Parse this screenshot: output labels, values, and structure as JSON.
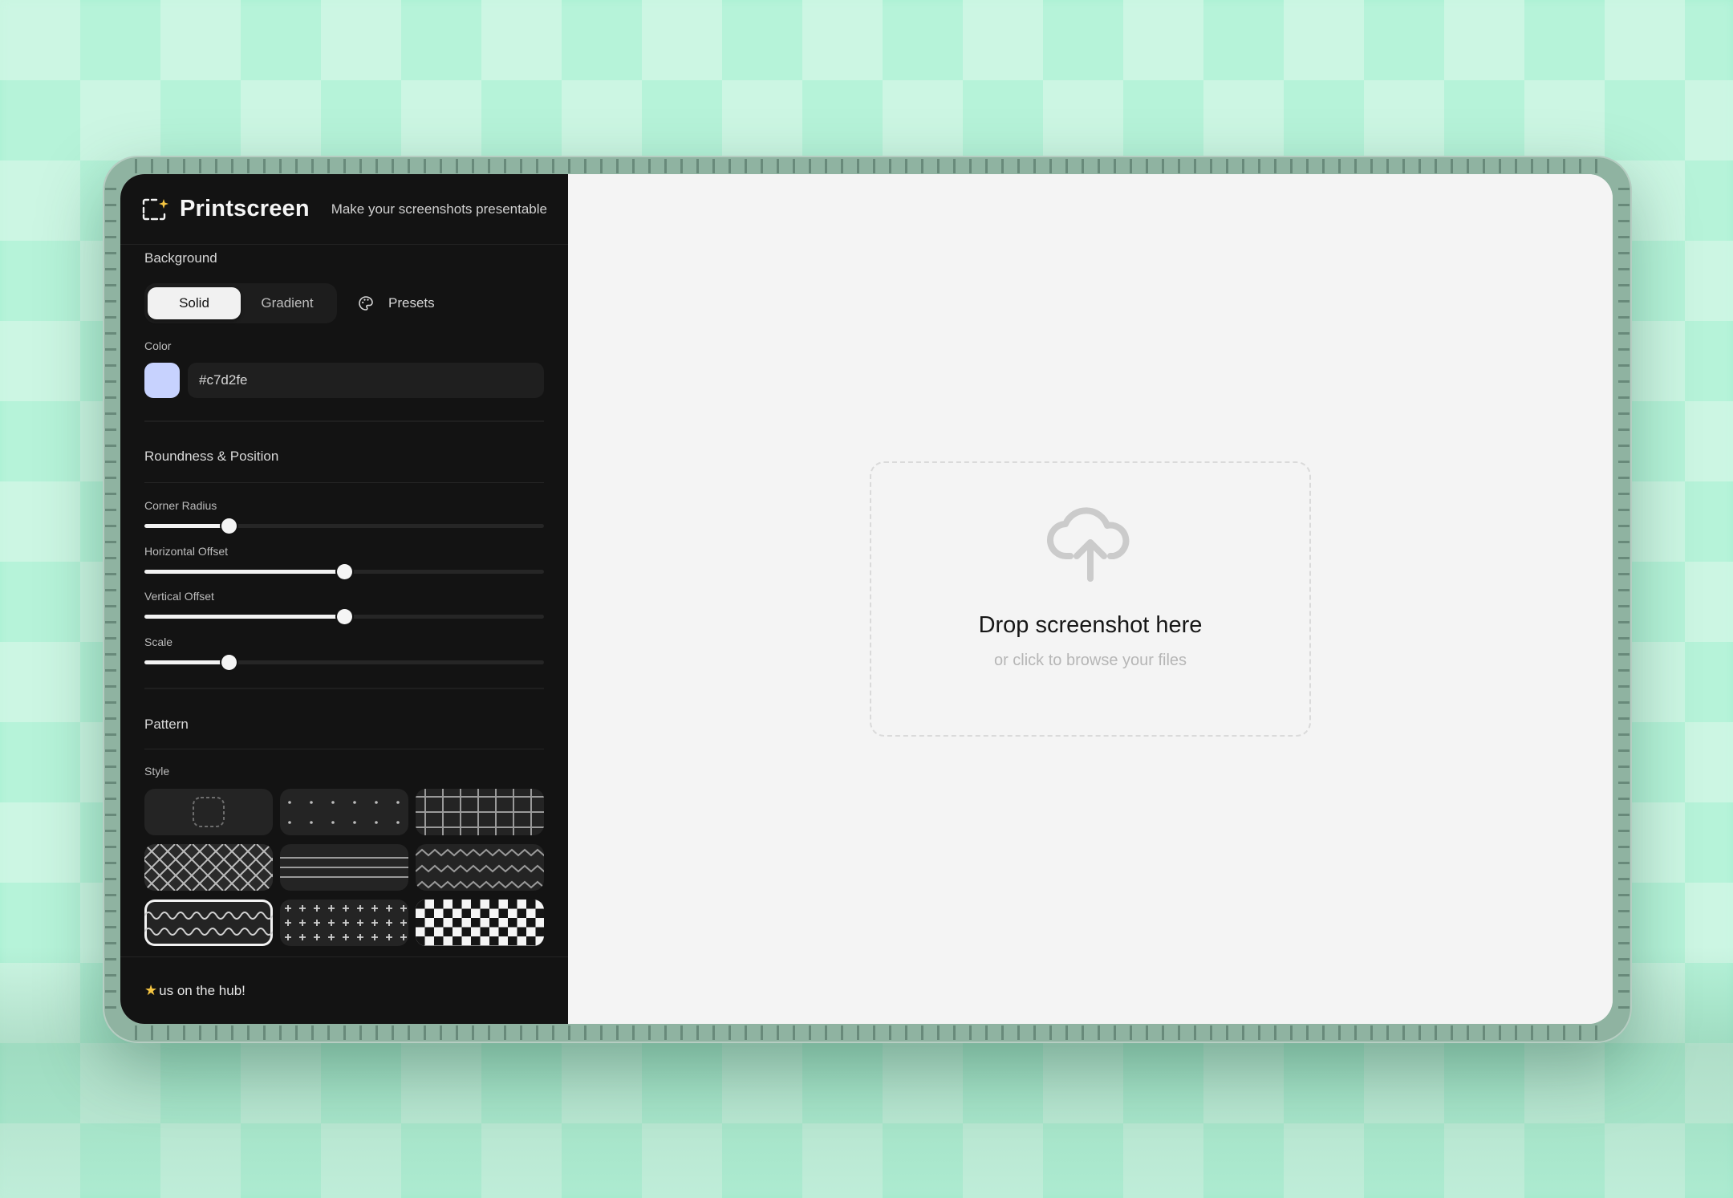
{
  "app": {
    "name": "Printscreen",
    "tagline": "Make your screenshots presentable"
  },
  "background": {
    "section_title": "Background",
    "modes": [
      "Solid",
      "Gradient"
    ],
    "active_mode": "Solid",
    "presets_label": "Presets",
    "color_label": "Color",
    "color_value": "#c7d2fe"
  },
  "roundness_position": {
    "section_title": "Roundness & Position",
    "sliders": [
      {
        "label": "Corner Radius",
        "fraction": 0.21
      },
      {
        "label": "Horizontal Offset",
        "fraction": 0.5
      },
      {
        "label": "Vertical Offset",
        "fraction": 0.5
      },
      {
        "label": "Scale",
        "fraction": 0.21
      }
    ]
  },
  "pattern": {
    "section_title": "Pattern",
    "style_label": "Style",
    "styles": [
      "none",
      "dots",
      "grid",
      "crosshatch",
      "lines",
      "zigzag",
      "waves",
      "plus",
      "checkerboard"
    ],
    "selected_style": "waves"
  },
  "footer": {
    "star_icon": "star-icon",
    "text": "us on the hub!"
  },
  "dropzone": {
    "icon": "cloud-upload-icon",
    "title": "Drop screenshot here",
    "subtitle": "or click to browse your files"
  }
}
